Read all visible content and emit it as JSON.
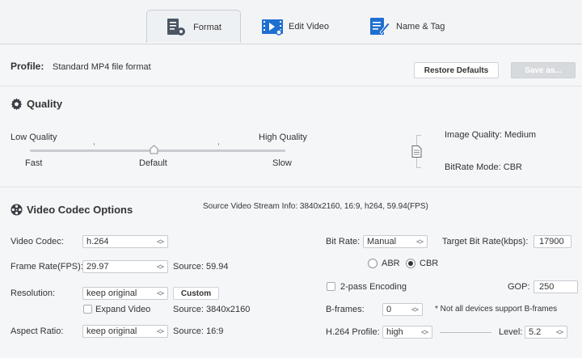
{
  "tabs": [
    {
      "label": "Format",
      "icon": "format-settings-icon",
      "active": true
    },
    {
      "label": "Edit Video",
      "icon": "edit-video-icon",
      "active": false
    },
    {
      "label": "Name & Tag",
      "icon": "name-tag-icon",
      "active": false
    }
  ],
  "profile": {
    "label": "Profile:",
    "value": "Standard MP4 file format",
    "restore_label": "Restore Defaults",
    "save_as_label": "Save as..."
  },
  "quality": {
    "title": "Quality",
    "low_label": "Low Quality",
    "high_label": "High Quality",
    "fast_label": "Fast",
    "default_label": "Default",
    "slow_label": "Slow",
    "slider_level": 0.5,
    "image_quality": "Image Quality: Medium",
    "bitrate_mode": "BitRate Mode: CBR"
  },
  "codec": {
    "title": "Video Codec Options",
    "source_info": "Source Video Stream Info: 3840x2160, 16:9, h264, 59.94(FPS)",
    "video_codec_label": "Video Codec:",
    "video_codec_value": "h.264",
    "frame_rate_label": "Frame Rate(FPS):",
    "frame_rate_value": "29.97",
    "frame_rate_source": "Source: 59.94",
    "resolution_label": "Resolution:",
    "resolution_value": "keep original",
    "custom_label": "Custom",
    "expand_video_label": "Expand Video",
    "resolution_source": "Source: 3840x2160",
    "aspect_label": "Aspect Ratio:",
    "aspect_value": "keep original",
    "aspect_source": "Source: 16:9",
    "bitrate_label": "Bit Rate:",
    "bitrate_value": "Manual",
    "target_bitrate_label": "Target Bit Rate(kbps):",
    "target_bitrate_value": "17900",
    "abr_label": "ABR",
    "cbr_label": "CBR",
    "selected_mode": "CBR",
    "two_pass_label": "2-pass Encoding",
    "gop_label": "GOP:",
    "gop_value": "250",
    "bframes_label": "B-frames:",
    "bframes_value": "0",
    "bframes_note": "* Not all devices support B-frames",
    "profile_label": "H.264 Profile:",
    "profile_value": "high",
    "level_label": "Level:",
    "level_value": "5.2"
  }
}
